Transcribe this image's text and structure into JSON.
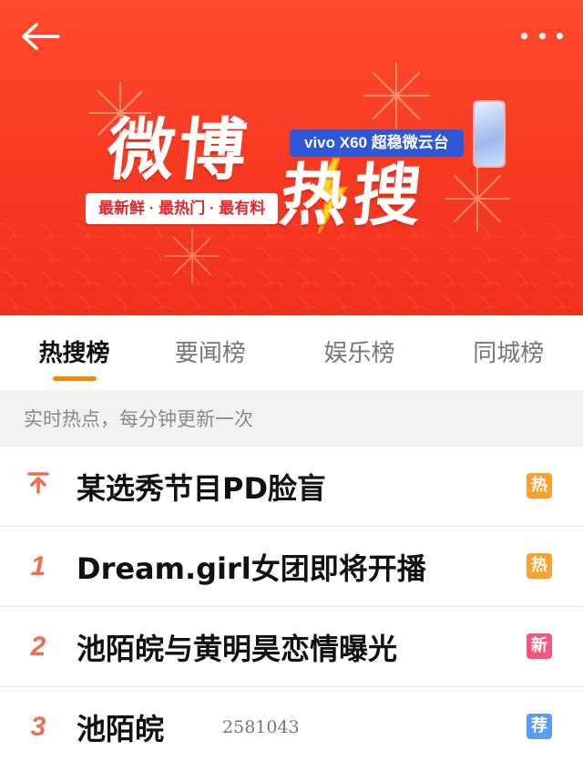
{
  "header": {
    "back_icon": "arrow-left-icon",
    "more_icon": "more-dots-icon",
    "banner": {
      "title_weibo": "微博",
      "title_resou": "热搜",
      "sponsor": "vivo X60 超稳微云台",
      "tagline": "最新鲜 · 最热门 · 最有料"
    }
  },
  "tabs": [
    {
      "label": "热搜榜",
      "active": true
    },
    {
      "label": "要闻榜",
      "active": false
    },
    {
      "label": "娱乐榜",
      "active": false
    },
    {
      "label": "同城榜",
      "active": false
    }
  ],
  "subtitle": "实时热点，每分钟更新一次",
  "list": [
    {
      "rank": "↑",
      "rank_icon": "pin-top-icon",
      "title": "某选秀节目PD脸盲",
      "count": "",
      "badge": "热",
      "badge_color": "#f8a12c"
    },
    {
      "rank": "1",
      "title": "Dream.girl女团即将开播",
      "count": "",
      "badge": "热",
      "badge_color": "#f8a12c"
    },
    {
      "rank": "2",
      "title": "池陌皖与黄明昊恋情曝光",
      "count": "",
      "badge": "新",
      "badge_color": "#f4577c"
    },
    {
      "rank": "3",
      "title": "池陌皖",
      "count": "2581043",
      "badge": "荐",
      "badge_color": "#5d9bf2"
    }
  ],
  "colors": {
    "banner_red": "#f63a22",
    "tab_indicator": "#ff8200",
    "rank_color": "#f26c4f"
  }
}
